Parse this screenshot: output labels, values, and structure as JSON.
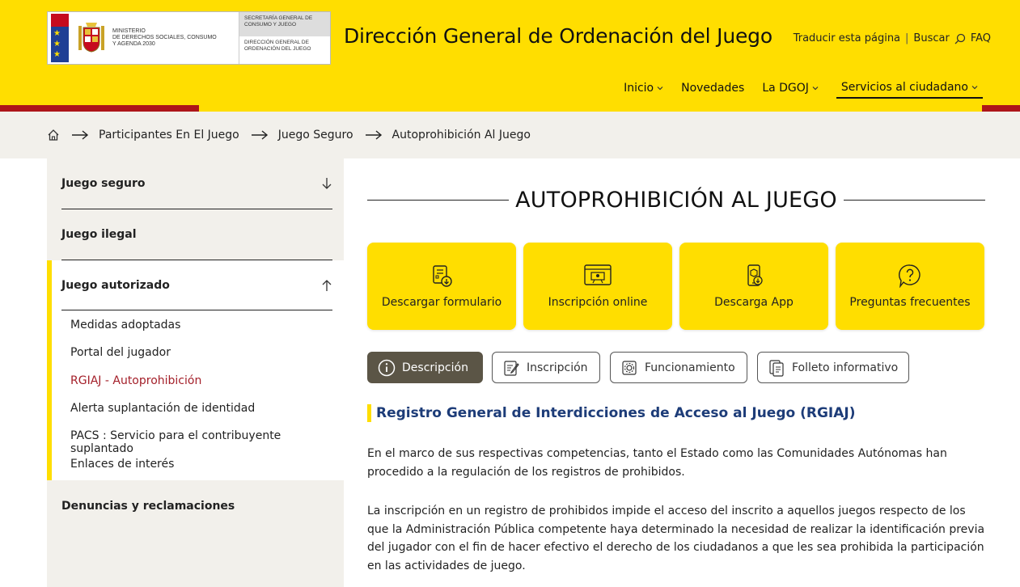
{
  "header": {
    "ministry": [
      "Ministerio",
      "de Derechos Sociales, Consumo",
      "y Agenda 2030"
    ],
    "secretaria": "Secretaría General de Consumo y Juego",
    "direccion": "Dirección General de Ordenación del Juego",
    "site_title": "Dirección General de Ordenación del Juego",
    "utility": {
      "translate": "Traducir esta página",
      "search": "Buscar",
      "faq": "FAQ"
    },
    "nav": [
      {
        "label": "Inicio"
      },
      {
        "label": "Novedades"
      },
      {
        "label": "La DGOJ"
      },
      {
        "label": "Servicios al ciudadano"
      }
    ]
  },
  "breadcrumb": {
    "home_icon": "home-icon",
    "items": [
      "Participantes En El Juego",
      "Juego Seguro",
      "Autoprohibición Al Juego"
    ]
  },
  "sidebar": {
    "sections": [
      {
        "label": "Juego seguro"
      },
      {
        "label": "Juego ilegal"
      },
      {
        "label": "Juego autorizado"
      },
      {
        "label": "Denuncias y reclamaciones"
      }
    ],
    "links": [
      "Medidas adoptadas",
      "Portal del jugador",
      "RGIAJ - Autoprohibición",
      "Alerta suplantación de identidad",
      "PACS : Servicio para el contribuyente suplantado",
      "Enlaces de interés"
    ]
  },
  "main": {
    "title": "AUTOPROHIBICIÓN AL JUEGO",
    "cards": [
      {
        "label": "Descargar formulario",
        "icon": "form-download-icon"
      },
      {
        "label": "Inscripción online",
        "icon": "online-presentation-icon"
      },
      {
        "label": "Descarga App",
        "icon": "app-download-icon"
      },
      {
        "label": "Preguntas frecuentes",
        "icon": "question-bubble-icon"
      }
    ],
    "tabs": [
      {
        "label": "Descripción",
        "icon": "info-icon"
      },
      {
        "label": "Inscripción",
        "icon": "form-edit-icon"
      },
      {
        "label": "Funcionamiento",
        "icon": "settings-icon"
      },
      {
        "label": "Folleto informativo",
        "icon": "document-icon"
      }
    ],
    "section_heading": "Registro General de Interdicciones de Acceso al Juego (RGIAJ)",
    "paragraphs": [
      "En el marco de sus respectivas competencias, tanto el Estado como las Comunidades Autónomas han procedido a la regulación de los registros de prohibidos.",
      "La inscripción en un registro de prohibidos impide el acceso del inscrito a aquellos juegos respecto de los que la Administración Pública competente haya determinado la necesidad de realizar la identificación previa del jugador con el fin de hacer efectivo el derecho de los ciudadanos a que les sea prohibida la participación en las actividades de juego."
    ]
  },
  "colors": {
    "brand_yellow": "#FFDE00",
    "brand_red": "#AD1519",
    "active_link": "#A4202A",
    "heading_blue": "#1d3c78",
    "active_tab": "#5B5546"
  }
}
